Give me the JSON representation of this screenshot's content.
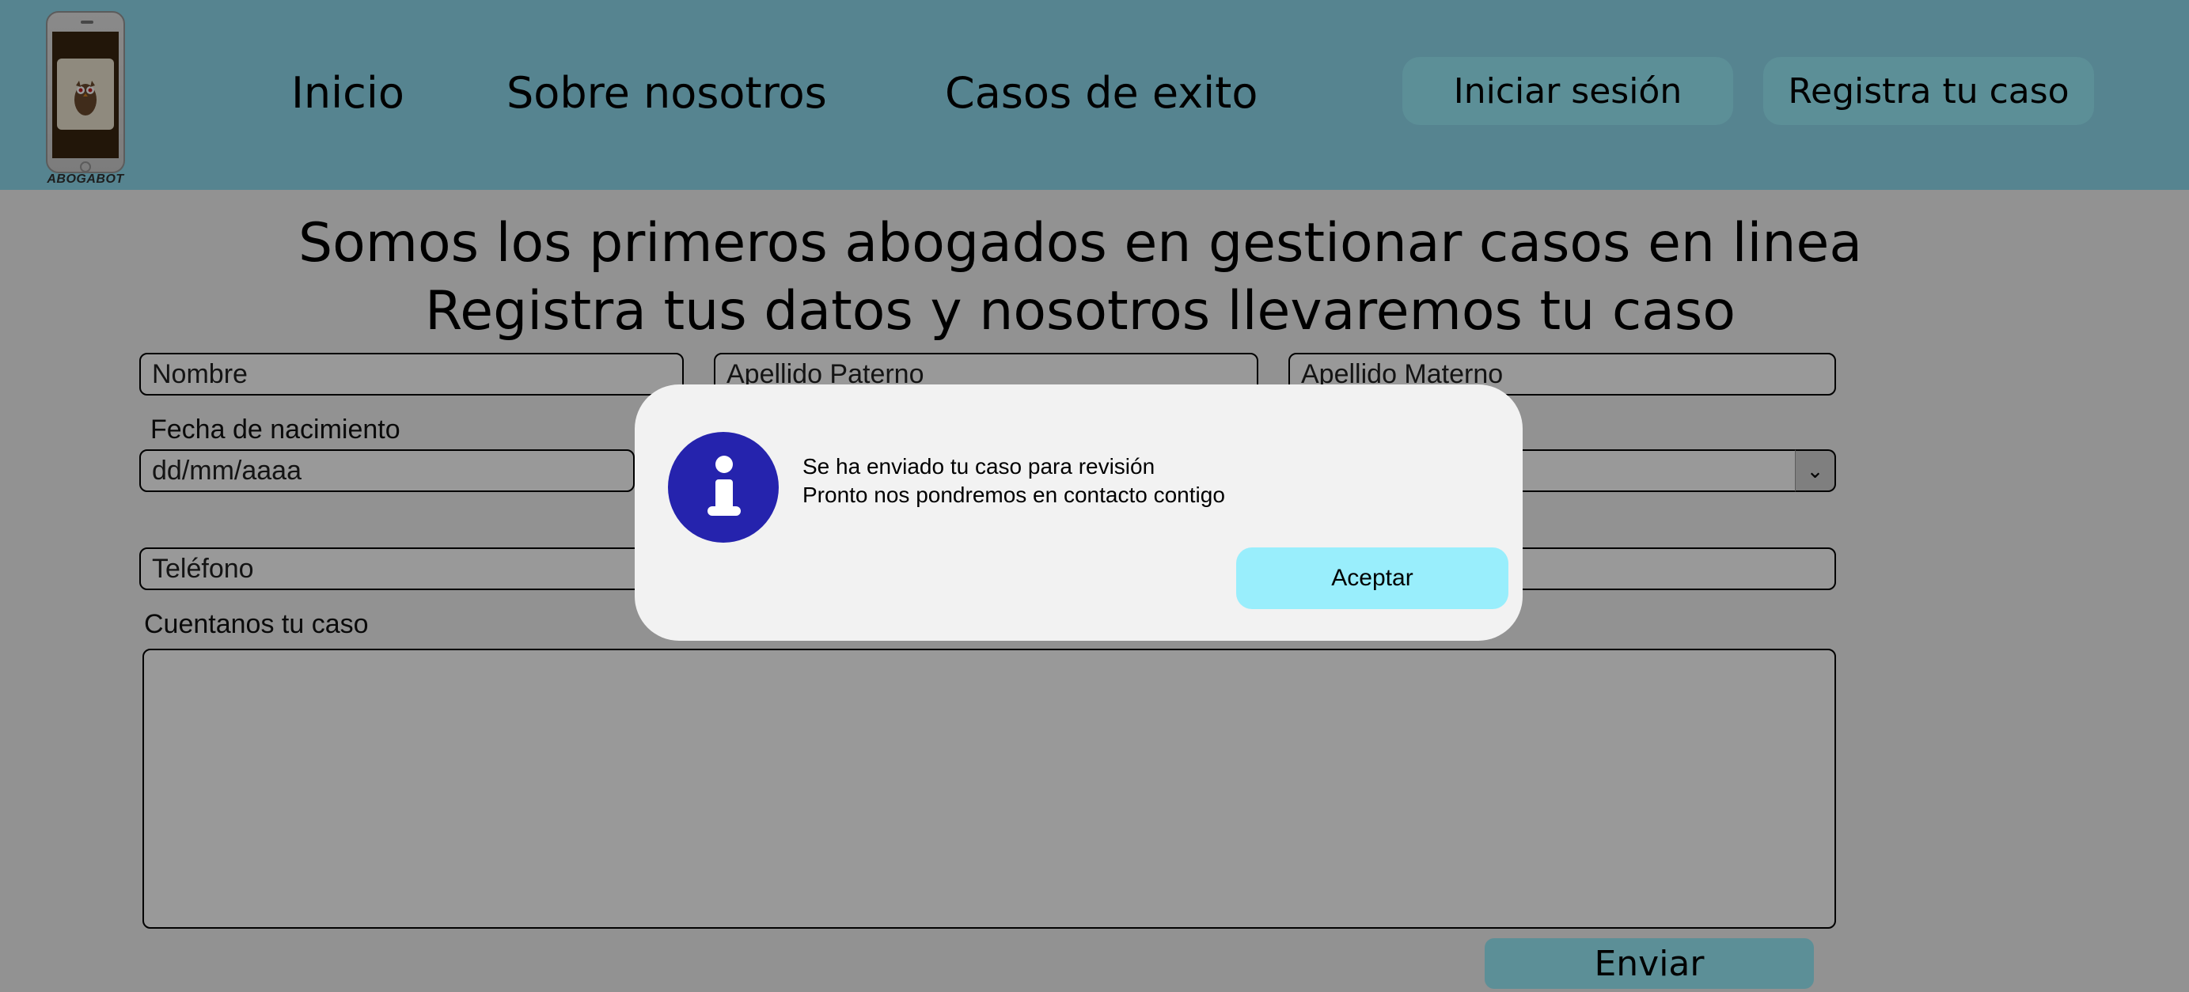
{
  "header": {
    "logo_text": "ABOGABOT",
    "nav": [
      "Inicio",
      "Sobre nosotros",
      "Casos de exito"
    ],
    "login_button": "Iniciar sesión",
    "register_button": "Registra tu caso"
  },
  "main": {
    "headline_line1": "Somos los primeros abogados en gestionar casos en linea",
    "headline_line2": "Registra tus datos y nosotros llevaremos tu caso",
    "fields": {
      "nombre_placeholder": "Nombre",
      "apellido_paterno_placeholder": "Apellido Paterno",
      "apellido_materno_placeholder": "Apellido Materno",
      "fecha_label": "Fecha de nacimiento",
      "fecha_placeholder": "dd/mm/aaaa",
      "telefono_placeholder": "Teléfono",
      "caso_label": "Cuentanos tu caso"
    },
    "send_button": "Enviar"
  },
  "dialog": {
    "icon": "info-icon",
    "message_line1": "Se ha enviado tu caso para revisión",
    "message_line2": "Pronto nos pondremos en contacto contigo",
    "accept_button": "Aceptar"
  },
  "colors": {
    "header_bg": "#8fdcf0",
    "button_bg": "#99eefc",
    "info_icon": "#2523ad",
    "overlay": "rgba(0,0,0,0.40)"
  }
}
